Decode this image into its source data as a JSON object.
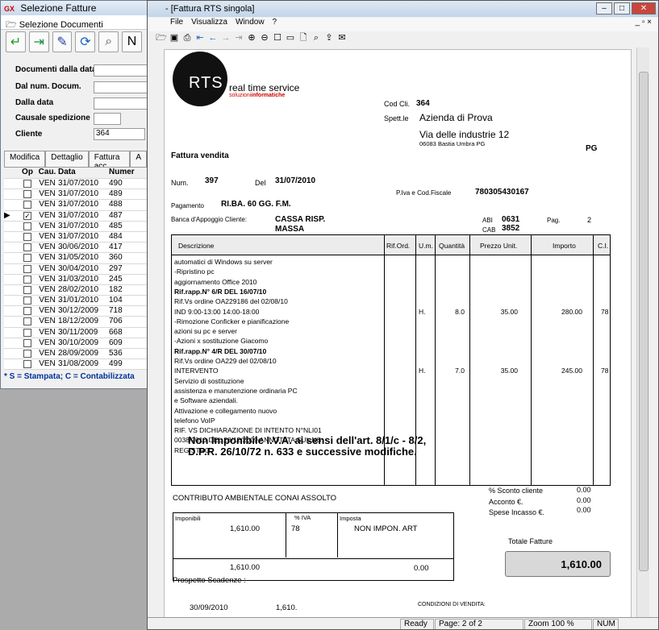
{
  "back_window": {
    "title": "Selezione Fatture",
    "logo_text": "GX",
    "subtitle": "Selezione Documenti",
    "filters": [
      {
        "label": "Documenti dalla data",
        "value": ""
      },
      {
        "label": "Dal num. Docum.",
        "value": ""
      },
      {
        "label": "Dalla data",
        "value": ""
      },
      {
        "label": "Causale spedizione",
        "value": ""
      },
      {
        "label": "Cliente",
        "value": "364"
      }
    ],
    "tabs": [
      "Modifica",
      "Dettaglio",
      "Fattura acc.",
      "A"
    ],
    "columns": [
      "Op",
      "Cau.",
      "Data",
      "Numer"
    ],
    "rows": [
      {
        "checked": false,
        "cau": "VEN",
        "data": "31/07/2010",
        "num": "490"
      },
      {
        "checked": false,
        "cau": "VEN",
        "data": "31/07/2010",
        "num": "489"
      },
      {
        "checked": false,
        "cau": "VEN",
        "data": "31/07/2010",
        "num": "488"
      },
      {
        "checked": true,
        "cau": "VEN",
        "data": "31/07/2010",
        "num": "487"
      },
      {
        "checked": false,
        "cau": "VEN",
        "data": "31/07/2010",
        "num": "485"
      },
      {
        "checked": false,
        "cau": "VEN",
        "data": "31/07/2010",
        "num": "484"
      },
      {
        "checked": false,
        "cau": "VEN",
        "data": "30/06/2010",
        "num": "417"
      },
      {
        "checked": false,
        "cau": "VEN",
        "data": "31/05/2010",
        "num": "360"
      },
      {
        "checked": false,
        "cau": "VEN",
        "data": "30/04/2010",
        "num": "297"
      },
      {
        "checked": false,
        "cau": "VEN",
        "data": "31/03/2010",
        "num": "245"
      },
      {
        "checked": false,
        "cau": "VEN",
        "data": "28/02/2010",
        "num": "182"
      },
      {
        "checked": false,
        "cau": "VEN",
        "data": "31/01/2010",
        "num": "104"
      },
      {
        "checked": false,
        "cau": "VEN",
        "data": "30/12/2009",
        "num": "718"
      },
      {
        "checked": false,
        "cau": "VEN",
        "data": "18/12/2009",
        "num": "706"
      },
      {
        "checked": false,
        "cau": "VEN",
        "data": "30/11/2009",
        "num": "668"
      },
      {
        "checked": false,
        "cau": "VEN",
        "data": "30/10/2009",
        "num": "609"
      },
      {
        "checked": false,
        "cau": "VEN",
        "data": "28/09/2009",
        "num": "536"
      },
      {
        "checked": false,
        "cau": "VEN",
        "data": "31/08/2009",
        "num": "499"
      }
    ],
    "current_row_marker": "▶",
    "legend": "* S = Stampata; C = Contabilizzata"
  },
  "main_window": {
    "title": "- [Fattura RTS singola]",
    "menu": [
      "File",
      "Visualizza",
      "Window",
      "?"
    ],
    "status": {
      "ready": "Ready",
      "page": "Page: 2 of 2",
      "zoom": "Zoom 100 %",
      "num": "NUM"
    }
  },
  "invoice": {
    "logo_big": "RTS",
    "logo_line1": "real time service",
    "logo_line2a": "soluzioni",
    "logo_line2b": "informatiche",
    "cod_cli_label": "Cod Cli.",
    "cod_cli": "364",
    "spett_label": "Spett.le",
    "client_name": "Azienda di Prova",
    "client_street": "Via delle industrie 12",
    "client_city": "06083 Bastia Umbra PG",
    "client_prov": "PG",
    "doc_type": "Fattura vendita",
    "num_label": "Num.",
    "num": "397",
    "del_label": "Del",
    "date": "31/07/2010",
    "piva_label": "P.Iva e Cod.Fiscale",
    "piva": "78030543",
    "piva_b": "0167",
    "pagamento_label": "Pagamento",
    "pagamento": "RI.BA. 60 GG. F.M.",
    "banca_label": "Banca d'Appoggio Cliente:",
    "banca1": "CASSA RISP.",
    "banca2": "MASSA",
    "abi_label": "ABI",
    "abi": "0631",
    "cab_label": "CAB",
    "cab": "3852",
    "pag_label": "Pag.",
    "pag": "2",
    "columns": [
      "Descrizione",
      "Rif.Ord.",
      "U.m.",
      "Quantità",
      "Prezzo Unit.",
      "Importo",
      "C.I."
    ],
    "lines": [
      {
        "text": "automatici di Windows su server"
      },
      {
        "text": "-Ripristino pc"
      },
      {
        "text": "aggiornamento Office 2010"
      },
      {
        "text": "Rif.rapp.N°      6/R DEL 16/07/10",
        "bold": true
      },
      {
        "text": "Rif.Vs ordine OA229186     del 02/08/10"
      },
      {
        "text": "                    IND 9:00-13:00 14:00-18:00",
        "um": "H.",
        "qty": "8.0",
        "price": "35.00",
        "amount": "280.00",
        "ci": "78"
      },
      {
        "text": "-Rimozione Conficker e pianificazione"
      },
      {
        "text": "azioni su pc e server"
      },
      {
        "text": "-Azioni x sostituzione Giacomo"
      },
      {
        "text": "Rif.rapp.N°      4/R DEL 30/07/10",
        "bold": true
      },
      {
        "text": "Rif.Vs ordine OA229       del 02/08/10"
      },
      {
        "text": "INTERVENTO",
        "um": "H.",
        "qty": "7.0",
        "price": "35.00",
        "amount": "245.00",
        "ci": "78"
      },
      {
        "text": "Servizio di sostituzione"
      },
      {
        "text": "assistenza e manutenzione ordinaria PC"
      },
      {
        "text": "e Software aziendali."
      },
      {
        "text": "Attivazione e collegamento nuovo"
      },
      {
        "text": "telefono VoIP"
      },
      {
        "text": "RIF. VS DICHIARAZIONE DI INTENTO N°NLI01"
      },
      {
        "text": "0038/2010 DEL 28/12/2009 ANNOTATA SUL NS"
      },
      {
        "text": " REGISTRO"
      }
    ],
    "nonimp1": "Non Imponibile I.V.A. ai sensi dell'art. 8/1/c - 8/2,",
    "nonimp2": "D.P.R. 26/10/72 n. 633 e successive modifiche.",
    "conai": "CONTRIBUTO AMBIENTALE CONAI ASSOLTO",
    "sconto_label": "% Sconto cliente",
    "sconto": "0.00",
    "acconto_label": "Acconto €.",
    "acconto": "0.00",
    "spese_label": "Spese Incasso  €.",
    "spese": "0.00",
    "imponibili_label": "Imponibili",
    "iva_label": "% IVA",
    "imposta_label": "Imposta",
    "imponibile": "1,610.00",
    "iva": "78",
    "imposta": "NON IMPON. ART",
    "imponibile_tot": "1,610.00",
    "imposta_tot": "0.00",
    "totale_label": "Totale Fatture",
    "totale": "1,610.00",
    "scadenze_label": "Prospetto Scadenze :",
    "scad_date": "30/09/2010",
    "scad_amount": "1,610.",
    "condizioni": "CONDIZIONI DI VENDITA:"
  }
}
